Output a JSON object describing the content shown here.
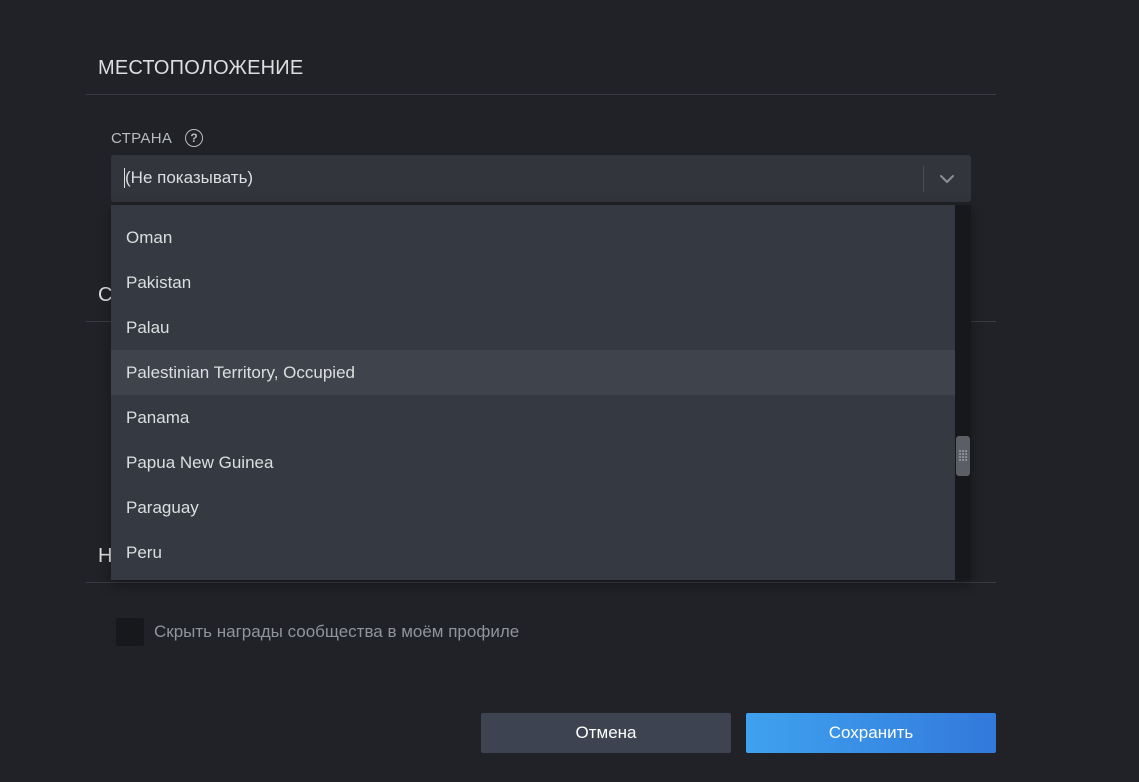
{
  "location": {
    "section_title": "МЕСТОПОЛОЖЕНИЕ",
    "country_label": "СТРАНА",
    "help_glyph": "?",
    "selected_value": "(Не показывать)",
    "chevron_icon": "chevron-down-icon"
  },
  "hidden_sections": {
    "second_heading_partial": "С",
    "third_heading_partial": "Н"
  },
  "dropdown": {
    "items": [
      {
        "label": "Oman"
      },
      {
        "label": "Pakistan"
      },
      {
        "label": "Palau"
      },
      {
        "label": "Palestinian Territory, Occupied",
        "highlighted": true
      },
      {
        "label": "Panama"
      },
      {
        "label": "Papua New Guinea"
      },
      {
        "label": "Paraguay"
      },
      {
        "label": "Peru"
      }
    ]
  },
  "awards": {
    "hide_awards_label": "Скрыть награды сообщества в моём профиле",
    "checked": false
  },
  "actions": {
    "cancel_label": "Отмена",
    "save_label": "Сохранить"
  },
  "colors": {
    "background": "#202227",
    "dropdown_bg": "#353942",
    "highlight_bg": "#3f434c",
    "save_gradient_start": "#3fa2ee",
    "save_gradient_end": "#3279dc",
    "cancel_bg": "#3d4350"
  }
}
